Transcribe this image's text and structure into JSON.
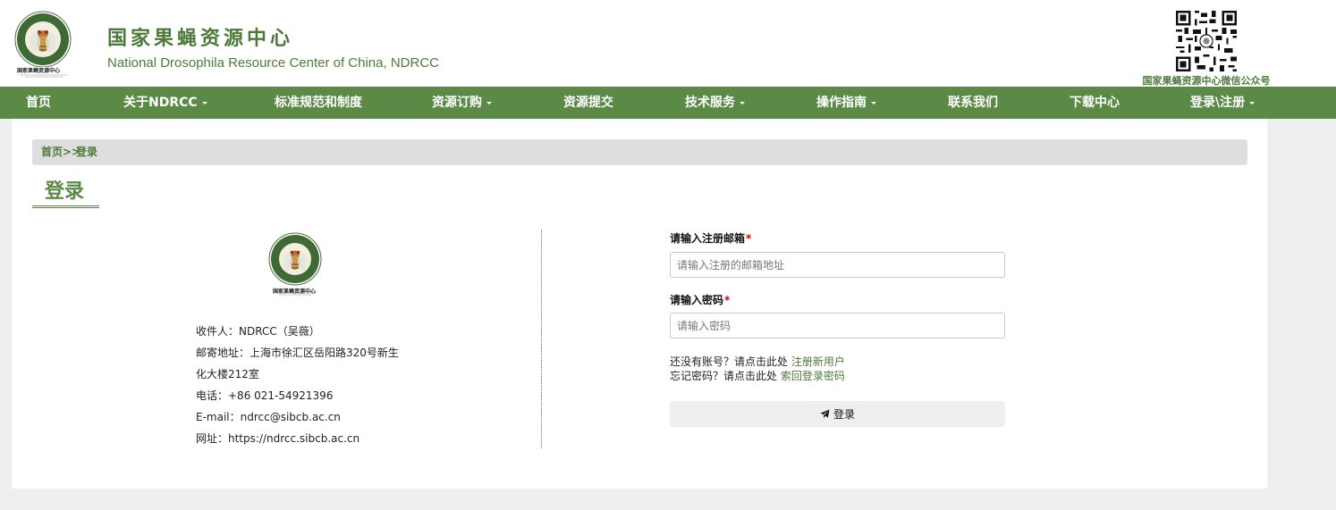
{
  "header": {
    "title_cn": "国家果蝇资源中心",
    "title_en": "National Drosophila Resource Center of China, NDRCC",
    "logo_text": "国家果蝇资源中心",
    "qr_caption": "国家果蝇资源中心微信公众号"
  },
  "nav": {
    "items": [
      {
        "label": "首页",
        "dropdown": false
      },
      {
        "label": "关于NDRCC",
        "dropdown": true
      },
      {
        "label": "标准规范和制度",
        "dropdown": false
      },
      {
        "label": "资源订购",
        "dropdown": true
      },
      {
        "label": "资源提交",
        "dropdown": false
      },
      {
        "label": "技术服务",
        "dropdown": true
      },
      {
        "label": "操作指南",
        "dropdown": true
      },
      {
        "label": "联系我们",
        "dropdown": false
      },
      {
        "label": "下载中心",
        "dropdown": false
      },
      {
        "label": "登录\\注册",
        "dropdown": true
      }
    ]
  },
  "breadcrumb": {
    "home": "首页",
    "separator": ">>",
    "current": "登录"
  },
  "page": {
    "heading": "登录"
  },
  "contact": {
    "recipient": "收件人：NDRCC（吴薇）",
    "address_line1": "邮寄地址：上海市徐汇区岳阳路320号新生",
    "address_line2": "化大楼212室",
    "phone": "电话：+86 021-54921396",
    "email": "E-mail：ndrcc@sibcb.ac.cn",
    "website": "网址：https://ndrcc.sibcb.ac.cn"
  },
  "form": {
    "email_label": "请输入注册邮箱",
    "email_placeholder": "请输入注册的邮箱地址",
    "email_value": "",
    "password_label": "请输入密码",
    "password_placeholder": "请输入密码",
    "password_value": "",
    "required_mark": "*",
    "no_account_text": "还没有账号？请点击此处",
    "register_link": "注册新用户",
    "forgot_text": "忘记密码？请点击此处",
    "recover_link": "索回登录密码",
    "login_button": "登录",
    "login_icon": "paper-plane-icon"
  },
  "colors": {
    "brand_green": "#5a8a45",
    "text_green": "#4d7a3a",
    "required_red": "#cc0000"
  }
}
